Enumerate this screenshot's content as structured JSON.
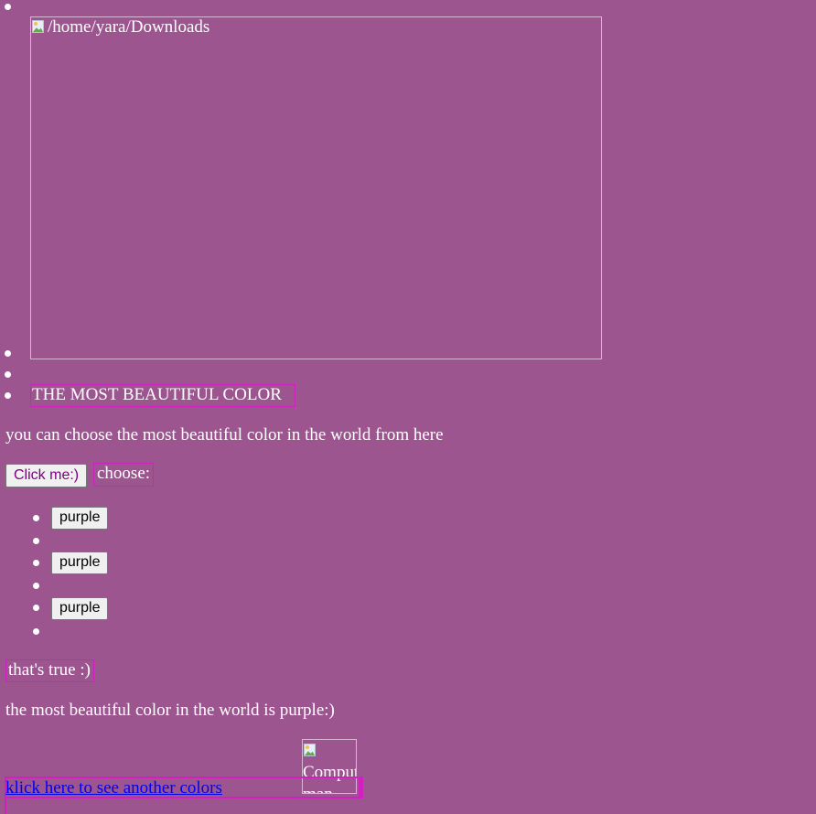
{
  "header_image": {
    "alt": "/home/yara/Downloads"
  },
  "title": "THE MOST BEAUTIFUL COLOR",
  "intro_text": "you can choose the most beautiful color in the world from here",
  "click_button_label": "Click me:)",
  "choose_label": "choose:",
  "color_options": [
    {
      "label": "purple"
    },
    {
      "label": "purple"
    },
    {
      "label": "purple"
    }
  ],
  "thats_true_label": "that's true :)",
  "statement_text": "the most beautiful color in the world is purple:)",
  "small_image": {
    "alt": "Computer man"
  },
  "another_colors_link": "klick here to see another colors",
  "colors": {
    "background": "#9d5590",
    "outline": "#d020c0",
    "link": "#0000ee",
    "text": "#ffffff"
  }
}
